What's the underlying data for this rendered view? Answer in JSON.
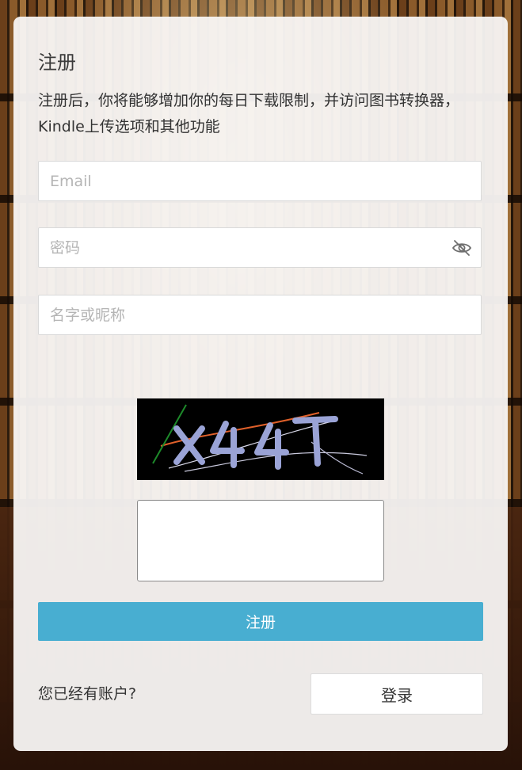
{
  "form": {
    "title": "注册",
    "description": "注册后，你将能够增加你的每日下载限制，并访问图书转换器，Kindle上传选项和其他功能",
    "email_placeholder": "Email",
    "password_placeholder": "密码",
    "name_placeholder": "名字或昵称",
    "password_toggle_icon": "eye-off-icon",
    "captcha_image_alt": "X44T",
    "captcha_input_value": "",
    "submit_label": "注册"
  },
  "footer": {
    "have_account_text": "您已经有账户?",
    "login_label": "登录"
  },
  "colors": {
    "accent": "#48aed1",
    "card_background": "#f8f6f4",
    "captcha_background": "#000000"
  }
}
